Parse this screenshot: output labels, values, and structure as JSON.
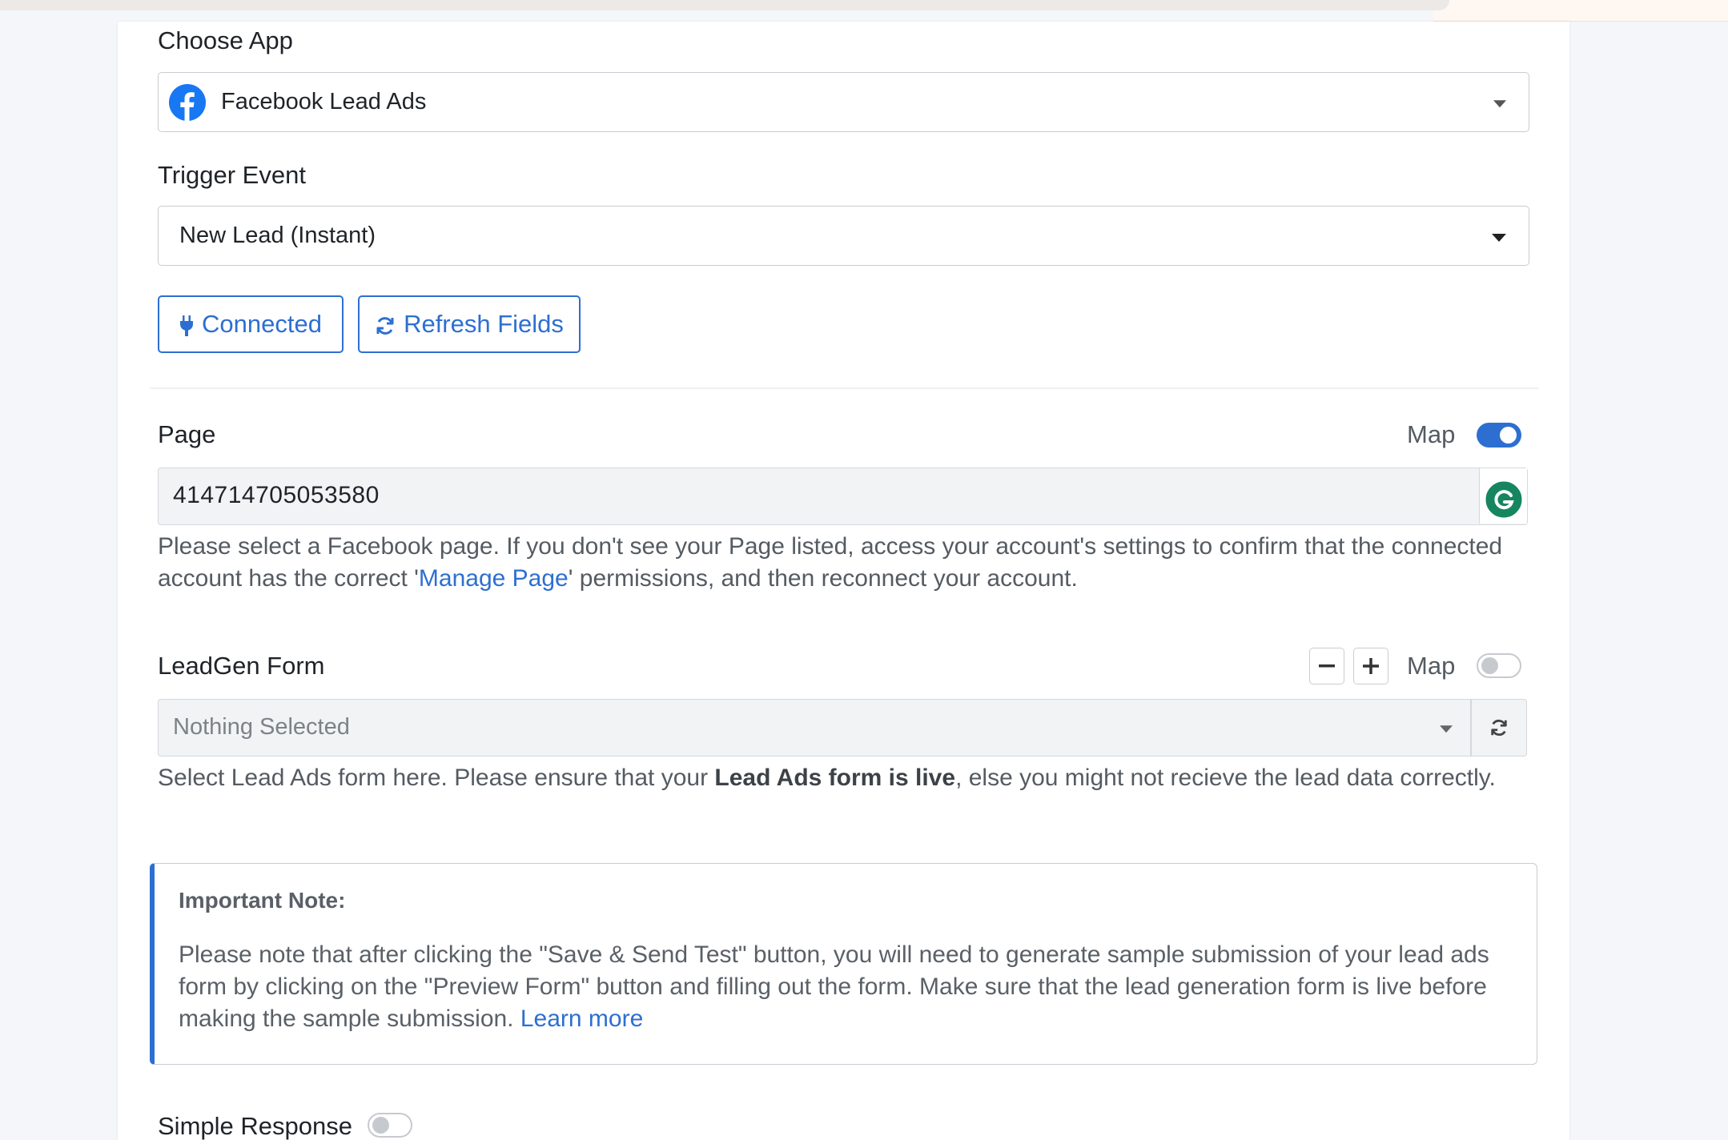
{
  "choose_app": {
    "label": "Choose App",
    "selected": "Facebook Lead Ads",
    "icon": "facebook-icon"
  },
  "trigger_event": {
    "label": "Trigger Event",
    "selected": "New Lead (Instant)"
  },
  "buttons": {
    "connected": "Connected",
    "refresh_fields": "Refresh Fields"
  },
  "page_field": {
    "label": "Page",
    "map_label": "Map",
    "map_on": true,
    "value": "414714705053580",
    "help_before": "Please select a Facebook page. If you don't see your Page listed, access your account's settings to confirm that the connected account has the correct '",
    "help_link": "Manage Page",
    "help_after": "' permissions, and then reconnect your account."
  },
  "leadgen_field": {
    "label": "LeadGen Form",
    "map_label": "Map",
    "map_on": false,
    "minus": "−",
    "plus": "+",
    "placeholder": "Nothing Selected",
    "help_before": "Select Lead Ads form here. Please ensure that your ",
    "help_bold": "Lead Ads form is live",
    "help_after": ", else you might not recieve the lead data correctly."
  },
  "note": {
    "title": "Important Note:",
    "body": "Please note that after clicking the \"Save & Send Test\" button, you will need to generate sample submission of your lead ads form by clicking on the \"Preview Form\" button and filling out the form. Make sure that the lead generation form is live before making the sample submission. ",
    "link": "Learn more"
  },
  "simple_response": {
    "label": "Simple Response",
    "on": false
  },
  "colors": {
    "accent": "#2d6fd1",
    "grammarly": "#15865f",
    "facebook": "#1877f2"
  }
}
